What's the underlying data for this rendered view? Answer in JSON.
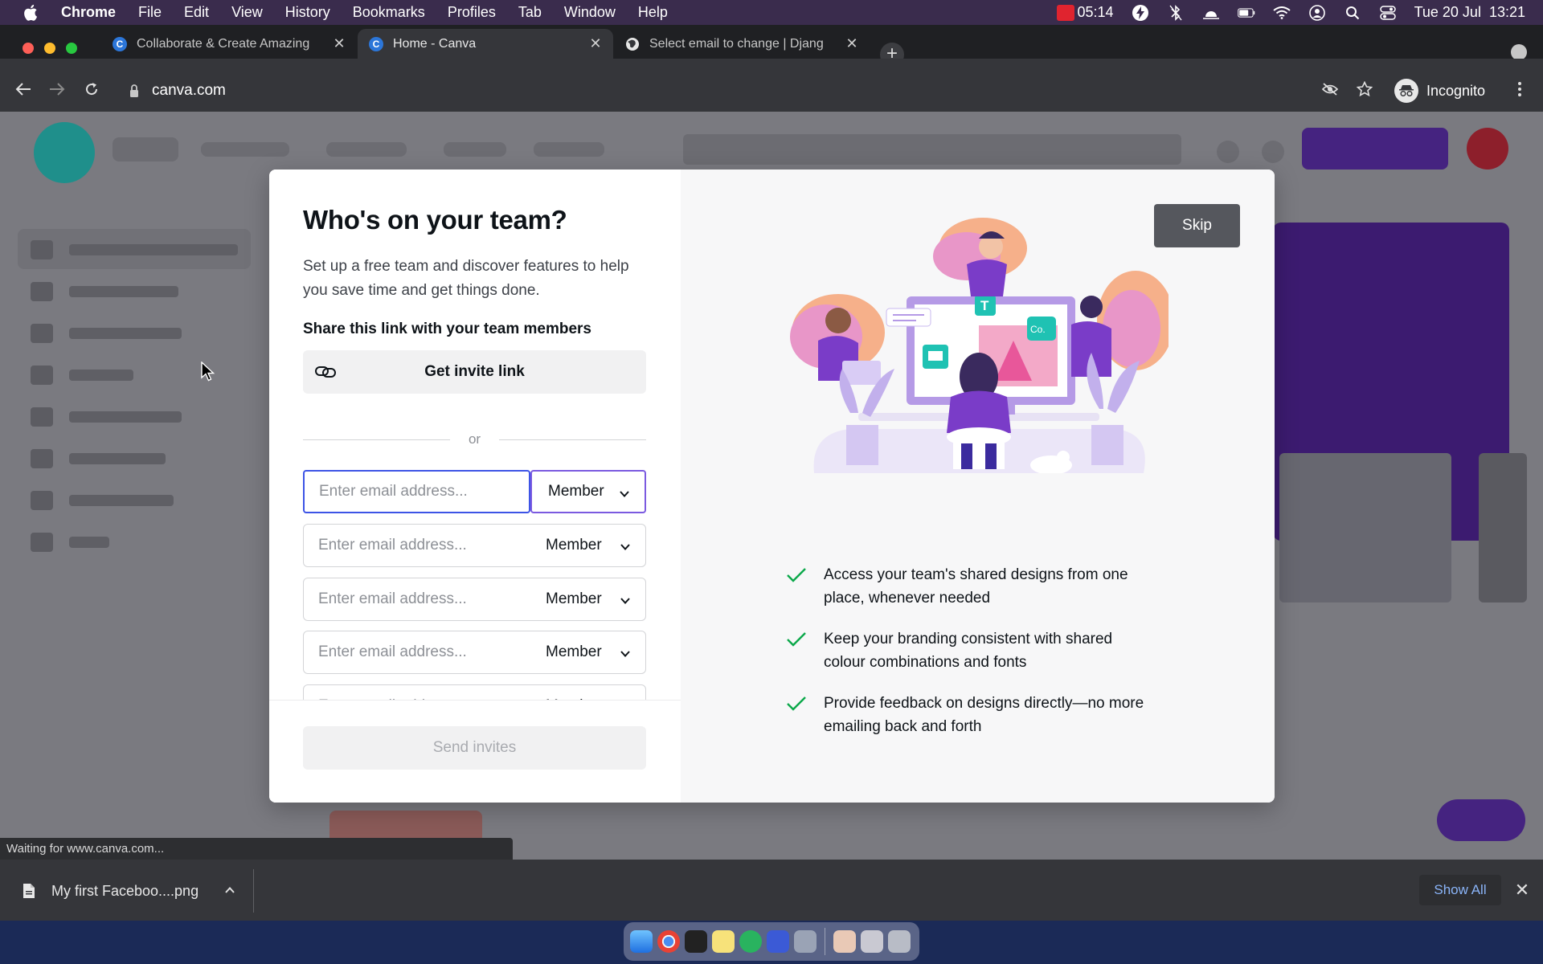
{
  "menubar": {
    "app_name": "Chrome",
    "items": [
      "File",
      "Edit",
      "View",
      "History",
      "Bookmarks",
      "Profiles",
      "Tab",
      "Window",
      "Help"
    ],
    "battery_time": "05:14",
    "datetime": "Tue 20 Jul  13:21"
  },
  "browser": {
    "tabs": [
      {
        "title": "Collaborate & Create Amazing",
        "favicon": "C",
        "active": false
      },
      {
        "title": "Home - Canva",
        "favicon": "C",
        "active": true
      },
      {
        "title": "Select email to change | Djang",
        "favicon": "globe",
        "active": false
      }
    ],
    "url": "canva.com",
    "profile_label": "Incognito"
  },
  "modal": {
    "title": "Who's on your team?",
    "description": "Set up a free team and discover features to help you save time and get things done.",
    "share_label": "Share this link with your team members",
    "invite_button": "Get invite link",
    "or_text": "or",
    "email_rows": [
      {
        "placeholder": "Enter email address...",
        "role": "Member"
      },
      {
        "placeholder": "Enter email address...",
        "role": "Member"
      },
      {
        "placeholder": "Enter email address...",
        "role": "Member"
      },
      {
        "placeholder": "Enter email address...",
        "role": "Member"
      },
      {
        "placeholder": "Enter email address...",
        "role": "Member"
      }
    ],
    "send_button": "Send invites",
    "skip_button": "Skip",
    "features": [
      "Access your team's shared designs from one place, whenever needed",
      "Keep your branding consistent with shared colour combinations and fonts",
      "Provide feedback on designs directly—no more emailing back and forth"
    ],
    "accent_color": "#3d54e6",
    "check_color": "#0ba84a"
  },
  "status_bar": {
    "text": "Waiting for www.canva.com..."
  },
  "download_shelf": {
    "file_name": "My first Faceboo....png",
    "show_all": "Show All"
  }
}
